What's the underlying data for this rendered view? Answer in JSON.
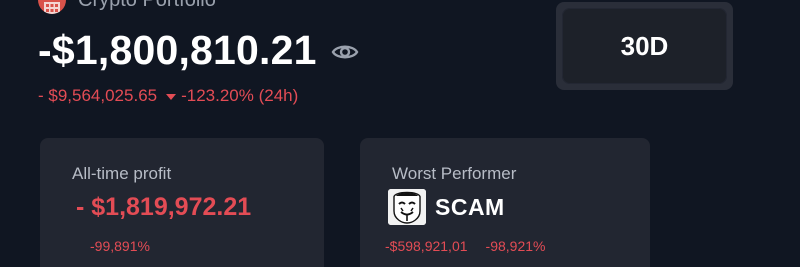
{
  "header": {
    "title": "Crypto Portfolio",
    "avatar_icon": "grid-building-icon"
  },
  "balance": {
    "value": "-$1,800,810.21",
    "visibility_icon": "eye-icon"
  },
  "change": {
    "amount": "- $9,564,025.65",
    "direction_icon": "caret-down-icon",
    "percent": "-123.20% (24h)"
  },
  "range": {
    "selected": "30D"
  },
  "cards": {
    "profit": {
      "label": "All-time profit",
      "value": "- $1,819,972.21",
      "percent": "-99,891%"
    },
    "worst": {
      "label": "Worst Performer",
      "asset_icon": "anonymous-mask-icon",
      "asset_name": "SCAM",
      "amount": "-$598,921,01",
      "percent": "-98,921%"
    }
  },
  "colors": {
    "background": "#101622",
    "card": "#222631",
    "negative": "#e34c55",
    "text_primary": "#ffffff",
    "text_secondary": "#b7bcc6"
  }
}
